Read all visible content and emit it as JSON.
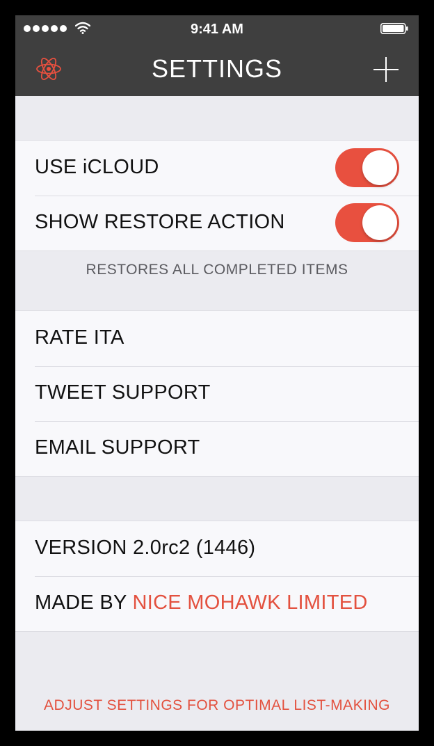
{
  "status_bar": {
    "time": "9:41 AM"
  },
  "nav": {
    "title": "SETTINGS",
    "left_icon": "atom-icon",
    "right_icon": "plus-icon"
  },
  "sync_section": {
    "use_icloud": {
      "label": "USE iCLOUD",
      "enabled": true
    },
    "show_restore_action": {
      "label": "SHOW RESTORE ACTION",
      "enabled": true
    },
    "footnote": "RESTORES ALL COMPLETED ITEMS"
  },
  "support_section": {
    "rate": "RATE ITA",
    "tweet": "TWEET SUPPORT",
    "email": "EMAIL SUPPORT"
  },
  "about_section": {
    "version": "VERSION 2.0rc2 (1446)",
    "made_by_prefix": "MADE BY ",
    "made_by_link": "NICE MOHAWK LIMITED"
  },
  "tagline": "ADJUST SETTINGS FOR OPTIMAL LIST-MAKING",
  "colors": {
    "accent": "#e8503f",
    "nav_bg": "#3f3f3f",
    "page_bg": "#ebebf0",
    "cell_bg": "#f8f8fb"
  }
}
